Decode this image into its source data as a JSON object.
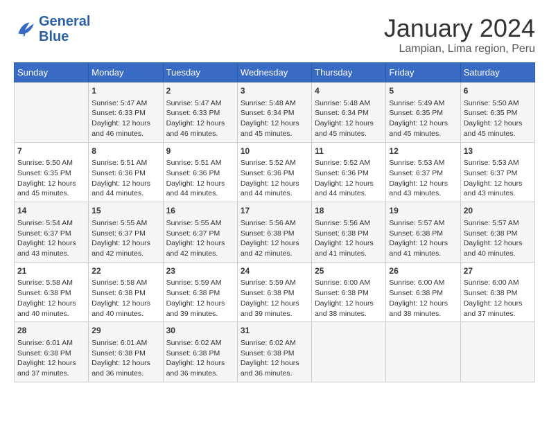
{
  "header": {
    "logo_line1": "General",
    "logo_line2": "Blue",
    "month": "January 2024",
    "location": "Lampian, Lima region, Peru"
  },
  "days_of_week": [
    "Sunday",
    "Monday",
    "Tuesday",
    "Wednesday",
    "Thursday",
    "Friday",
    "Saturday"
  ],
  "weeks": [
    [
      {
        "day": "",
        "content": ""
      },
      {
        "day": "1",
        "content": "Sunrise: 5:47 AM\nSunset: 6:33 PM\nDaylight: 12 hours\nand 46 minutes."
      },
      {
        "day": "2",
        "content": "Sunrise: 5:47 AM\nSunset: 6:33 PM\nDaylight: 12 hours\nand 46 minutes."
      },
      {
        "day": "3",
        "content": "Sunrise: 5:48 AM\nSunset: 6:34 PM\nDaylight: 12 hours\nand 45 minutes."
      },
      {
        "day": "4",
        "content": "Sunrise: 5:48 AM\nSunset: 6:34 PM\nDaylight: 12 hours\nand 45 minutes."
      },
      {
        "day": "5",
        "content": "Sunrise: 5:49 AM\nSunset: 6:35 PM\nDaylight: 12 hours\nand 45 minutes."
      },
      {
        "day": "6",
        "content": "Sunrise: 5:50 AM\nSunset: 6:35 PM\nDaylight: 12 hours\nand 45 minutes."
      }
    ],
    [
      {
        "day": "7",
        "content": "Sunrise: 5:50 AM\nSunset: 6:35 PM\nDaylight: 12 hours\nand 45 minutes."
      },
      {
        "day": "8",
        "content": "Sunrise: 5:51 AM\nSunset: 6:36 PM\nDaylight: 12 hours\nand 44 minutes."
      },
      {
        "day": "9",
        "content": "Sunrise: 5:51 AM\nSunset: 6:36 PM\nDaylight: 12 hours\nand 44 minutes."
      },
      {
        "day": "10",
        "content": "Sunrise: 5:52 AM\nSunset: 6:36 PM\nDaylight: 12 hours\nand 44 minutes."
      },
      {
        "day": "11",
        "content": "Sunrise: 5:52 AM\nSunset: 6:36 PM\nDaylight: 12 hours\nand 44 minutes."
      },
      {
        "day": "12",
        "content": "Sunrise: 5:53 AM\nSunset: 6:37 PM\nDaylight: 12 hours\nand 43 minutes."
      },
      {
        "day": "13",
        "content": "Sunrise: 5:53 AM\nSunset: 6:37 PM\nDaylight: 12 hours\nand 43 minutes."
      }
    ],
    [
      {
        "day": "14",
        "content": "Sunrise: 5:54 AM\nSunset: 6:37 PM\nDaylight: 12 hours\nand 43 minutes."
      },
      {
        "day": "15",
        "content": "Sunrise: 5:55 AM\nSunset: 6:37 PM\nDaylight: 12 hours\nand 42 minutes."
      },
      {
        "day": "16",
        "content": "Sunrise: 5:55 AM\nSunset: 6:37 PM\nDaylight: 12 hours\nand 42 minutes."
      },
      {
        "day": "17",
        "content": "Sunrise: 5:56 AM\nSunset: 6:38 PM\nDaylight: 12 hours\nand 42 minutes."
      },
      {
        "day": "18",
        "content": "Sunrise: 5:56 AM\nSunset: 6:38 PM\nDaylight: 12 hours\nand 41 minutes."
      },
      {
        "day": "19",
        "content": "Sunrise: 5:57 AM\nSunset: 6:38 PM\nDaylight: 12 hours\nand 41 minutes."
      },
      {
        "day": "20",
        "content": "Sunrise: 5:57 AM\nSunset: 6:38 PM\nDaylight: 12 hours\nand 40 minutes."
      }
    ],
    [
      {
        "day": "21",
        "content": "Sunrise: 5:58 AM\nSunset: 6:38 PM\nDaylight: 12 hours\nand 40 minutes."
      },
      {
        "day": "22",
        "content": "Sunrise: 5:58 AM\nSunset: 6:38 PM\nDaylight: 12 hours\nand 40 minutes."
      },
      {
        "day": "23",
        "content": "Sunrise: 5:59 AM\nSunset: 6:38 PM\nDaylight: 12 hours\nand 39 minutes."
      },
      {
        "day": "24",
        "content": "Sunrise: 5:59 AM\nSunset: 6:38 PM\nDaylight: 12 hours\nand 39 minutes."
      },
      {
        "day": "25",
        "content": "Sunrise: 6:00 AM\nSunset: 6:38 PM\nDaylight: 12 hours\nand 38 minutes."
      },
      {
        "day": "26",
        "content": "Sunrise: 6:00 AM\nSunset: 6:38 PM\nDaylight: 12 hours\nand 38 minutes."
      },
      {
        "day": "27",
        "content": "Sunrise: 6:00 AM\nSunset: 6:38 PM\nDaylight: 12 hours\nand 37 minutes."
      }
    ],
    [
      {
        "day": "28",
        "content": "Sunrise: 6:01 AM\nSunset: 6:38 PM\nDaylight: 12 hours\nand 37 minutes."
      },
      {
        "day": "29",
        "content": "Sunrise: 6:01 AM\nSunset: 6:38 PM\nDaylight: 12 hours\nand 36 minutes."
      },
      {
        "day": "30",
        "content": "Sunrise: 6:02 AM\nSunset: 6:38 PM\nDaylight: 12 hours\nand 36 minutes."
      },
      {
        "day": "31",
        "content": "Sunrise: 6:02 AM\nSunset: 6:38 PM\nDaylight: 12 hours\nand 36 minutes."
      },
      {
        "day": "",
        "content": ""
      },
      {
        "day": "",
        "content": ""
      },
      {
        "day": "",
        "content": ""
      }
    ]
  ]
}
